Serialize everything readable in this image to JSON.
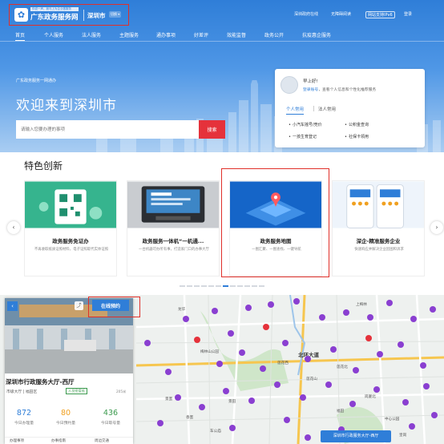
{
  "header": {
    "slogan": "你说一声，我马上为企业做服务",
    "portal_title": "广东政务服务网",
    "city": "深圳市",
    "switch_label": "切换 ▾",
    "links": [
      "深圳政府在线",
      "无障碍阅读",
      "网站支持IPv6",
      "登录"
    ]
  },
  "nav": {
    "items": [
      "首页",
      "个人服务",
      "法人服务",
      "主题服务",
      "通办事项",
      "好差评",
      "效能监督",
      "政务公开",
      "抗疫惠企服务"
    ],
    "active_index": 0
  },
  "hero": {
    "breadcrumb": "广东政务服务一网通办",
    "welcome": "欢迎来到深圳市",
    "search_placeholder": "请输入您要办理的事项",
    "search_button": "搜索"
  },
  "login_card": {
    "greeting": "早上好!",
    "login_link": "登录账号",
    "login_tip": "，查看个人信息和个性化推荐服务",
    "tabs": [
      "个人常用",
      "法人常用"
    ],
    "links": [
      "小汽车摇号/竞价",
      "公积金查询",
      "一孩生育登记",
      "社保卡领用"
    ]
  },
  "features": {
    "title": "特色创新",
    "prev_icon": "chevron-left-icon",
    "next_icon": "chevron-right-icon",
    "cards": [
      {
        "title": "政务服务免证办",
        "desc": "不再收取纸质证照材料，电子证照取代实体证照"
      },
      {
        "title": "政务服务一体机“一机通...",
        "desc": "一台机器可办所有事，打造家门口的办事大厅"
      },
      {
        "title": "政务服务地图",
        "desc": "一图汇聚、一图查找、一键导航"
      },
      {
        "title": "深企-精准服务企业",
        "desc": "快速响应并解决企业因困和诉求"
      }
    ],
    "highlight_color": "#e0302a"
  },
  "map_panel": {
    "back_icon": "back-arrow-icon",
    "share_icon": "share-icon",
    "book_button": "在线预约",
    "hall_name": "深圳市行政服务大厅-西厅",
    "hall_level": "市级大厅 | 福田区",
    "badge": "人员密度低",
    "distance": "205米",
    "stats": [
      {
        "value": "872",
        "label": "今日办理量",
        "color": "#2f7ed8"
      },
      {
        "value": "80",
        "label": "今日预约量",
        "color": "#f0a020"
      },
      {
        "value": "436",
        "label": "今日取号量",
        "color": "#3b9a4e"
      }
    ],
    "bottom_tabs": [
      "办理事项",
      "办事指南",
      "周边交通"
    ]
  },
  "map": {
    "labels": [
      "上梅林",
      "梅林山公园",
      "北环大道",
      "莲花北",
      "莲花西",
      "莲花山",
      "香蜜",
      "车公庙",
      "福田",
      "景田",
      "皇岗",
      "岗厦北",
      "中心公园",
      "龙华",
      "景蜜"
    ],
    "popup": "深圳市行政服务大厅-西厅",
    "marker_color": "#8a3fd1"
  },
  "colors": {
    "brand": "#2f7ed8",
    "search_button": "#e5323b"
  }
}
